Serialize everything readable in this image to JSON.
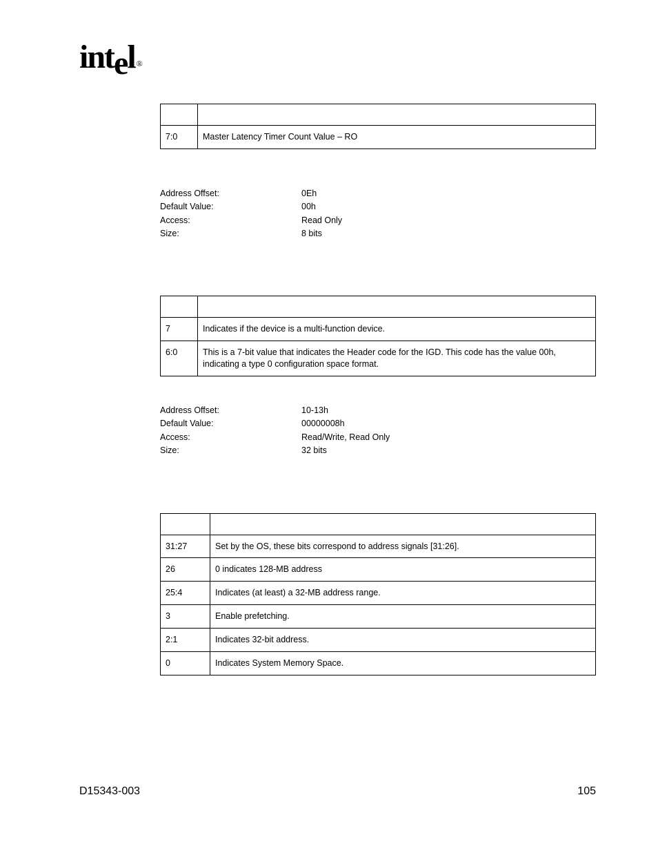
{
  "logo_alt": "intel",
  "table1": {
    "header_bit": "",
    "header_desc": "",
    "rows": [
      {
        "bit": "7:0",
        "desc": "Master Latency Timer Count Value – RO"
      }
    ]
  },
  "attrs1": {
    "addr_offset_label": "Address Offset:",
    "addr_offset_value": "0Eh",
    "default_value_label": "Default Value:",
    "default_value_value": "00h",
    "access_label": "Access:",
    "access_value": "Read Only",
    "size_label": "Size:",
    "size_value": "8 bits"
  },
  "table2": {
    "header_bit": "",
    "header_desc": "",
    "rows": [
      {
        "bit": "7",
        "desc": " Indicates if the device is a multi-function device."
      },
      {
        "bit": "6:0",
        "desc": " This is a 7-bit value that indicates the Header code for the IGD. This code has the value 00h, indicating a type 0 configuration space format."
      }
    ]
  },
  "attrs2": {
    "addr_offset_label": "Address Offset:",
    "addr_offset_value": "10-13h",
    "default_value_label": "Default Value:",
    "default_value_value": "00000008h",
    "access_label": "Access:",
    "access_value": "Read/Write, Read Only",
    "size_label": "Size:",
    "size_value": "32 bits"
  },
  "table3": {
    "header_bit": "",
    "header_desc": "",
    "rows": [
      {
        "bit": "31:27",
        "desc": " Set by the OS, these bits correspond to address signals [31:26]."
      },
      {
        "bit": "26",
        "desc": " 0 indicates 128-MB address"
      },
      {
        "bit": "25:4",
        "desc": " Indicates (at least) a 32-MB address range."
      },
      {
        "bit": "3",
        "desc": " Enable prefetching."
      },
      {
        "bit": "2:1",
        "desc": " Indicates 32-bit address."
      },
      {
        "bit": "0",
        "desc": " Indicates System Memory Space."
      }
    ]
  },
  "footer": {
    "doc_id": "D15343-003",
    "page_num": "105"
  }
}
